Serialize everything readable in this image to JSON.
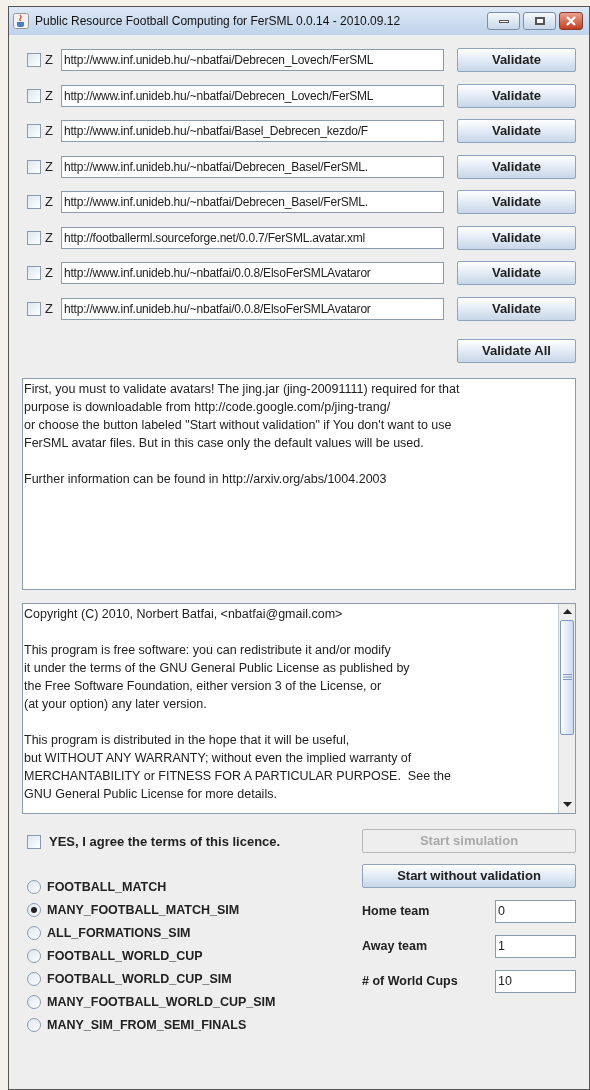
{
  "window": {
    "title": "Public Resource Football Computing for FerSML 0.0.14 - 2010.09.12"
  },
  "avatars": [
    {
      "checked": false,
      "z": "Z",
      "url": "http://www.inf.unideb.hu/~nbatfai/Debrecen_Lovech/FerSML",
      "button": "Validate"
    },
    {
      "checked": false,
      "z": "Z",
      "url": "http://www.inf.unideb.hu/~nbatfai/Debrecen_Lovech/FerSML",
      "button": "Validate"
    },
    {
      "checked": false,
      "z": "Z",
      "url": "http://www.inf.unideb.hu/~nbatfai/Basel_Debrecen_kezdo/F",
      "button": "Validate"
    },
    {
      "checked": false,
      "z": "Z",
      "url": "http://www.inf.unideb.hu/~nbatfai/Debrecen_Basel/FerSML.",
      "button": "Validate"
    },
    {
      "checked": false,
      "z": "Z",
      "url": "http://www.inf.unideb.hu/~nbatfai/Debrecen_Basel/FerSML.",
      "button": "Validate"
    },
    {
      "checked": false,
      "z": "Z",
      "url": "http://footballerml.sourceforge.net/0.0.7/FerSML.avatar.xml",
      "button": "Validate"
    },
    {
      "checked": false,
      "z": "Z",
      "url": "http://www.inf.unideb.hu/~nbatfai/0.0.8/ElsoFerSMLAvataror",
      "button": "Validate"
    },
    {
      "checked": false,
      "z": "Z",
      "url": "http://www.inf.unideb.hu/~nbatfai/0.0.8/ElsoFerSMLAvataror",
      "button": "Validate"
    }
  ],
  "validate_all": "Validate All",
  "info_text": [
    [
      "First, you must to validate avatars! The jing.jar (jing-20091111) required for that",
      "purpose is downloadable from http://code.google.com/p/jing-trang/",
      "or choose the button labeled \"Start without validation\" if You don't want to use",
      "FerSML avatar files. But in this case only the default values will be used."
    ],
    [
      "Further information can be found in http://arxiv.org/abs/1004.2003"
    ]
  ],
  "license_text": [
    [
      "Copyright (C) 2010, Norbert Batfai, <nbatfai@gmail.com>"
    ],
    [
      "This program is free software: you can redistribute it and/or modify",
      "it under the terms of the GNU General Public License as published by",
      "the Free Software Foundation, either version 3 of the License, or",
      "(at your option) any later version."
    ],
    [
      "This program is distributed in the hope that it will be useful,",
      "but WITHOUT ANY WARRANTY; without even the implied warranty of",
      "MERCHANTABILITY or FITNESS FOR A PARTICULAR PURPOSE.  See the",
      "GNU General Public License for more details."
    ]
  ],
  "agree": {
    "label": "YES, I agree the terms of this licence.",
    "checked": false
  },
  "start_simulation": {
    "label": "Start simulation",
    "disabled": true
  },
  "start_without_validation": {
    "label": "Start without validation",
    "disabled": false
  },
  "modes": [
    {
      "label": "FOOTBALL_MATCH",
      "selected": false
    },
    {
      "label": "MANY_FOOTBALL_MATCH_SIM",
      "selected": true
    },
    {
      "label": "ALL_FORMATIONS_SIM",
      "selected": false
    },
    {
      "label": "FOOTBALL_WORLD_CUP",
      "selected": false
    },
    {
      "label": "FOOTBALL_WORLD_CUP_SIM",
      "selected": false
    },
    {
      "label": "MANY_FOOTBALL_WORLD_CUP_SIM",
      "selected": false
    },
    {
      "label": "MANY_SIM_FROM_SEMI_FINALS",
      "selected": false
    }
  ],
  "settings": [
    {
      "label": "Home team",
      "value": "0"
    },
    {
      "label": "Away team",
      "value": "1"
    },
    {
      "label": "# of World Cups",
      "value": "10"
    }
  ]
}
